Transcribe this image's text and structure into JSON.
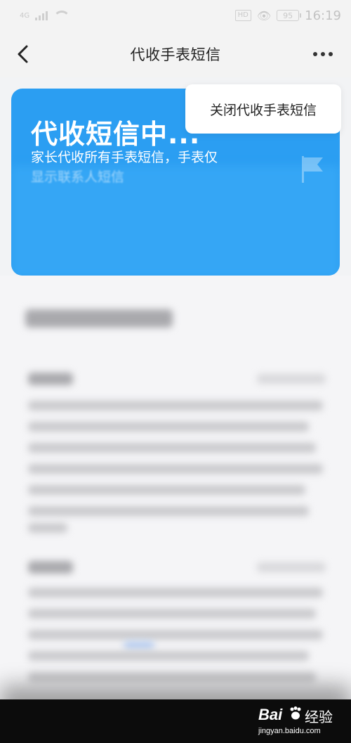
{
  "status_bar": {
    "network": "4G",
    "hd": "HD",
    "battery": "95",
    "time": "16:19"
  },
  "header": {
    "title": "代收手表短信"
  },
  "hero": {
    "title": "代收短信中...",
    "desc_line1": "家长代收所有手表短信，手表仅",
    "desc_line2": "显示联系人短信"
  },
  "menu": {
    "items": [
      "关闭代收手表短信"
    ]
  },
  "watermark": {
    "brand": "Bai",
    "brand_suffix": "经验",
    "url": "jingyan.baidu.com"
  },
  "colors": {
    "accent_blue": "#2b9ef2",
    "background": "#f2f3f5"
  }
}
